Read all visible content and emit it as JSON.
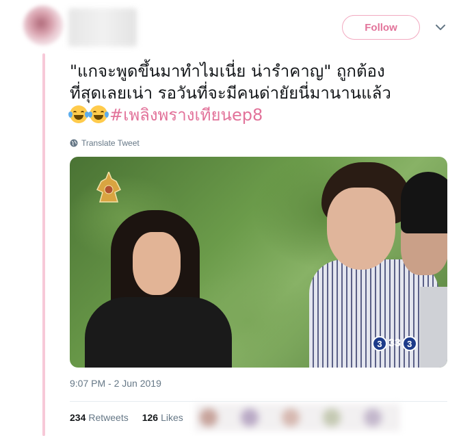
{
  "header": {
    "follow_label": "Follow",
    "caret_icon": "chevron-down-icon"
  },
  "tweet": {
    "line1": "\"แกจะพูดขึ้นมาทำไมเนี่ย น่ารำคาญ\" ถูกต้อง",
    "line2": "ที่สุดเลยเน่า รอวันที่จะมีคนด่ายัยนี่มานานแล้ว",
    "emoji": "face-with-tears-of-joy",
    "hashtag": "#เพลิงพรางเทียนep8",
    "translate_label": "Translate Tweet",
    "timestamp": "9:07 PM - 2 Jun 2019"
  },
  "media": {
    "channel_text": "33"
  },
  "stats": {
    "retweets_count": "234",
    "retweets_label": "Retweets",
    "likes_count": "126",
    "likes_label": "Likes"
  },
  "colors": {
    "accent": "#e2739a",
    "thread_line": "#f7c9d8",
    "muted": "#657786"
  }
}
